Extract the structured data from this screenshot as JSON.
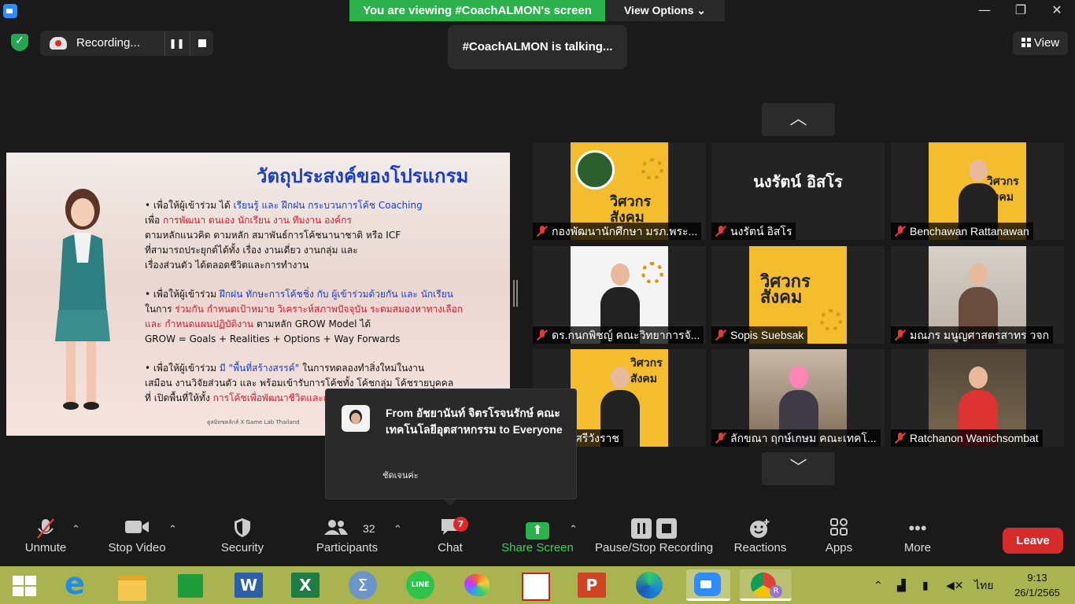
{
  "window": {
    "viewing_banner": "You are viewing #CoachALMON's screen",
    "view_options": "View Options ⌄",
    "talking_notice": "#CoachALMON is talking...",
    "view_button": "View"
  },
  "recording": {
    "label": "Recording..."
  },
  "slide": {
    "title": "วัตถุประสงค์ของโปรแกรม",
    "p1": [
      "• เพื่อให้ผู้เข้าร่วม ได้ ",
      "เรียนรู้ และ ฝึกฝน กระบวนการโค้ช Coaching",
      "เพื่อ ",
      "การพัฒนา ตนเอง นักเรียน งาน ทีมงาน องค์กร",
      "ตามหลักแนวคิด ตามหลัก สมาพันธ์การโค้ชนานาชาติ หรือ ICF",
      "ที่สามารถประยุกต์ได้ทั้ง เรื่อง งานเดี่ยว งานกลุ่ม และ",
      "เรื่องส่วนตัว ได้ตลอดชีวิตและการทำงาน"
    ],
    "p2": [
      "• เพื่อให้ผู้เข้าร่วม ",
      "ฝึกฝน ทักษะการโค้ชชิ่ง กับ ผู้เข้าร่วมด้วยกัน และ นักเรียน",
      "ในการ ",
      "ร่วมกัน กำหนดเป้าหมาย วิเคราะห์สภาพปัจจุบัน ระดมสมองหาทางเลือก",
      "และ กำหนดแผนปฏิบัติงาน",
      " ตามหลัก GROW Model ได้",
      "GROW = Goals + Realities + Options + Way Forwards"
    ],
    "p3": [
      "• เพื่อให้ผู้เข้าร่วม ",
      "มี \"พื้นที่สร้างสรรค์\"",
      " ในการทดลองทำสิ่งใหม่ในงาน",
      "เสมือน งานวิจัยส่วนตัว และ พร้อมเข้ารับการโค้ชทั้ง โค้ชกลุ่ม โค้ชรายบุคคล",
      "ที่ เปิดพื้นที่ให้ทั้ง ",
      "การโค้ชเพื่อพัฒนาชีวิตและการทำงาน"
    ],
    "footer": "ดูสมิทชคลิกส์ X Game Lab Thailand"
  },
  "gallery": {
    "tiles": [
      {
        "name": "กองพัฒนานักศึกษา มรภ.พระ...",
        "kind": "logo",
        "brand": "วิศวกร สังคม"
      },
      {
        "name": "นงรัตน์ อิสโร",
        "kind": "text",
        "display": "นงรัตน์ อิสโร"
      },
      {
        "name": "Benchawan Rattanawan",
        "kind": "person",
        "brand": "วิศวกร สังคม"
      },
      {
        "name": "ดร.กนกพิชญ์ คณะวิทยาการจั...",
        "kind": "person-white"
      },
      {
        "name": "Sopis Suebsak",
        "kind": "logo",
        "brand": "วิศวกร สังคม"
      },
      {
        "name": "มณภร มนูญศาสตรสาทร วจก",
        "kind": "room"
      },
      {
        "name": "มาศ ศรีวังราช",
        "kind": "person",
        "brand": "วิศวกร สังคม"
      },
      {
        "name": "ลักขณา ฤกษ์เกษม คณะเทคโ...",
        "kind": "pink"
      },
      {
        "name": "Ratchanon Wanichsombat",
        "kind": "market"
      }
    ]
  },
  "chat": {
    "from": "From อัชยานันท์ จิตรโรจนรักษ์ คณะเทคโนโลยีอุตสาหกรรม to Everyone",
    "message": "ชัดเจนค่ะ"
  },
  "toolbar": {
    "unmute": "Unmute",
    "stop_video": "Stop Video",
    "security": "Security",
    "participants": "Participants",
    "participants_count": "32",
    "chat": "Chat",
    "chat_badge": "7",
    "share_screen": "Share Screen",
    "pause_stop": "Pause/Stop Recording",
    "reactions": "Reactions",
    "apps": "Apps",
    "more": "More",
    "leave": "Leave"
  },
  "taskbar": {
    "language": "ไทย",
    "time": "9:13",
    "date": "26/1/2565"
  },
  "colors": {
    "banner_green": "#2bb24c",
    "leave_red": "#d52b2b",
    "slide_title_blue": "#1a3dc8",
    "slide_red": "#e0162b",
    "taskbar": "#a9b34f"
  }
}
